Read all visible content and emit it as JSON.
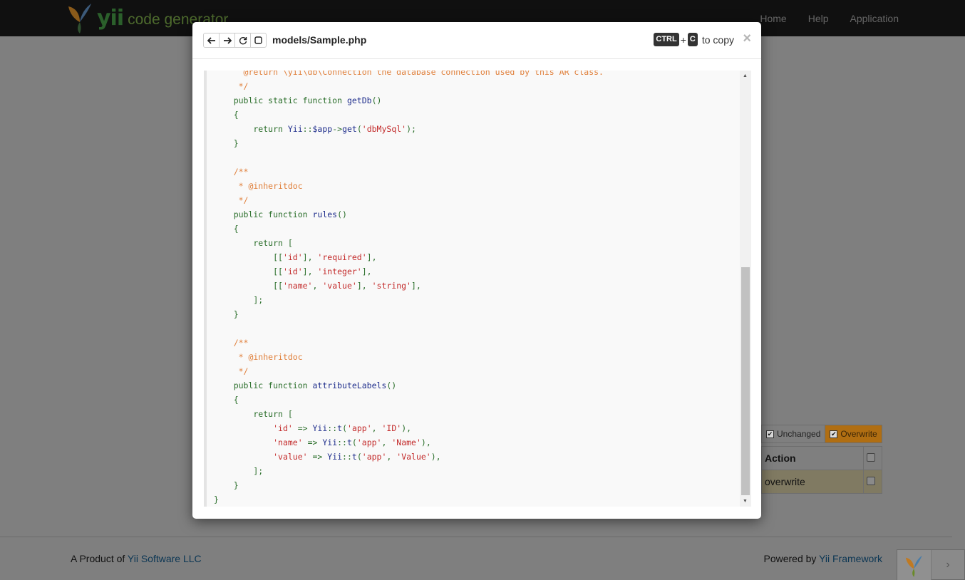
{
  "navbar": {
    "brand_yii": "yii",
    "brand_text": "code generator",
    "links": [
      "Home",
      "Help",
      "Application"
    ]
  },
  "background": {
    "filters": {
      "unchanged": "Unchanged",
      "overwrite": "Overwrite"
    },
    "table": {
      "header_action": "Action",
      "row_action": "overwrite"
    }
  },
  "footer": {
    "left_prefix": "A Product of ",
    "left_link": "Yii Software LLC",
    "right_prefix": "Powered by ",
    "right_link": "Yii Framework"
  },
  "modal": {
    "title": "models/Sample.php",
    "copy_hint": {
      "key1": "CTRL",
      "plus": "+",
      "key2": "C",
      "text": "to copy"
    },
    "close": "×",
    "code_lines": [
      [
        [
          "c-com",
          "      @return \\yii\\db\\Connection the database connection used by this AR class."
        ]
      ],
      [
        [
          "c-com",
          "     */"
        ]
      ],
      [
        [
          "c-kw",
          "    public static function "
        ],
        [
          "c-fn",
          "getDb"
        ],
        [
          "c-kw",
          "()"
        ]
      ],
      [
        [
          "c-kw",
          "    {"
        ]
      ],
      [
        [
          "c-kw",
          "        return "
        ],
        [
          "c-fn",
          "Yii"
        ],
        [
          "c-kw",
          "::"
        ],
        [
          "c-var",
          "$app"
        ],
        [
          "c-kw",
          "->"
        ],
        [
          "c-fn",
          "get"
        ],
        [
          "c-kw",
          "("
        ],
        [
          "c-str",
          "'dbMySql'"
        ],
        [
          "c-kw",
          ");"
        ]
      ],
      [
        [
          "c-kw",
          "    }"
        ]
      ],
      [
        [
          "c-kw",
          ""
        ]
      ],
      [
        [
          "c-com",
          "    /**"
        ]
      ],
      [
        [
          "c-com",
          "     * @inheritdoc"
        ]
      ],
      [
        [
          "c-com",
          "     */"
        ]
      ],
      [
        [
          "c-kw",
          "    public function "
        ],
        [
          "c-fn",
          "rules"
        ],
        [
          "c-kw",
          "()"
        ]
      ],
      [
        [
          "c-kw",
          "    {"
        ]
      ],
      [
        [
          "c-kw",
          "        return ["
        ]
      ],
      [
        [
          "c-kw",
          "            [["
        ],
        [
          "c-str",
          "'id'"
        ],
        [
          "c-kw",
          "], "
        ],
        [
          "c-str",
          "'required'"
        ],
        [
          "c-kw",
          "],"
        ]
      ],
      [
        [
          "c-kw",
          "            [["
        ],
        [
          "c-str",
          "'id'"
        ],
        [
          "c-kw",
          "], "
        ],
        [
          "c-str",
          "'integer'"
        ],
        [
          "c-kw",
          "],"
        ]
      ],
      [
        [
          "c-kw",
          "            [["
        ],
        [
          "c-str",
          "'name'"
        ],
        [
          "c-kw",
          ", "
        ],
        [
          "c-str",
          "'value'"
        ],
        [
          "c-kw",
          "], "
        ],
        [
          "c-str",
          "'string'"
        ],
        [
          "c-kw",
          "],"
        ]
      ],
      [
        [
          "c-kw",
          "        ];"
        ]
      ],
      [
        [
          "c-kw",
          "    }"
        ]
      ],
      [
        [
          "c-kw",
          ""
        ]
      ],
      [
        [
          "c-com",
          "    /**"
        ]
      ],
      [
        [
          "c-com",
          "     * @inheritdoc"
        ]
      ],
      [
        [
          "c-com",
          "     */"
        ]
      ],
      [
        [
          "c-kw",
          "    public function "
        ],
        [
          "c-fn",
          "attributeLabels"
        ],
        [
          "c-kw",
          "()"
        ]
      ],
      [
        [
          "c-kw",
          "    {"
        ]
      ],
      [
        [
          "c-kw",
          "        return ["
        ]
      ],
      [
        [
          "c-kw",
          "            "
        ],
        [
          "c-str",
          "'id'"
        ],
        [
          "c-kw",
          " => "
        ],
        [
          "c-fn",
          "Yii"
        ],
        [
          "c-kw",
          "::"
        ],
        [
          "c-fn",
          "t"
        ],
        [
          "c-kw",
          "("
        ],
        [
          "c-str",
          "'app'"
        ],
        [
          "c-kw",
          ", "
        ],
        [
          "c-str",
          "'ID'"
        ],
        [
          "c-kw",
          "),"
        ]
      ],
      [
        [
          "c-kw",
          "            "
        ],
        [
          "c-str",
          "'name'"
        ],
        [
          "c-kw",
          " => "
        ],
        [
          "c-fn",
          "Yii"
        ],
        [
          "c-kw",
          "::"
        ],
        [
          "c-fn",
          "t"
        ],
        [
          "c-kw",
          "("
        ],
        [
          "c-str",
          "'app'"
        ],
        [
          "c-kw",
          ", "
        ],
        [
          "c-str",
          "'Name'"
        ],
        [
          "c-kw",
          "),"
        ]
      ],
      [
        [
          "c-kw",
          "            "
        ],
        [
          "c-str",
          "'value'"
        ],
        [
          "c-kw",
          " => "
        ],
        [
          "c-fn",
          "Yii"
        ],
        [
          "c-kw",
          "::"
        ],
        [
          "c-fn",
          "t"
        ],
        [
          "c-kw",
          "("
        ],
        [
          "c-str",
          "'app'"
        ],
        [
          "c-kw",
          ", "
        ],
        [
          "c-str",
          "'Value'"
        ],
        [
          "c-kw",
          "),"
        ]
      ],
      [
        [
          "c-kw",
          "        ];"
        ]
      ],
      [
        [
          "c-kw",
          "    }"
        ]
      ],
      [
        [
          "c-kw",
          "}"
        ]
      ]
    ],
    "scroll_position": 0.6
  },
  "colors": {
    "overlay": "#7f7f7f",
    "navbar": "#101010",
    "overwrite_badge": "#b06e12",
    "code_comment": "#e07f3a",
    "code_string": "#c32a2a",
    "code_function": "#1f2e8c",
    "code_keyword": "#2a6e2a"
  },
  "icons": [
    "yii-logo-icon",
    "arrow-left-icon",
    "arrow-right-icon",
    "refresh-icon",
    "square-icon",
    "close-icon",
    "chevron-right-icon"
  ]
}
